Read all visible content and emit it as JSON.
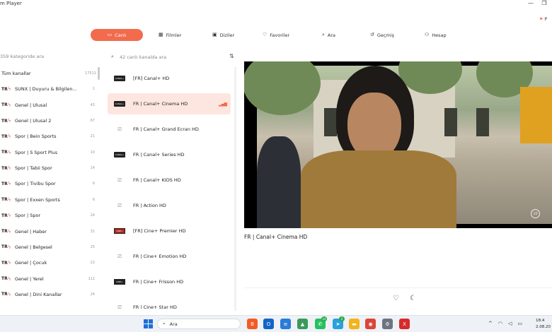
{
  "window": {
    "title": "m Player",
    "minimize": "—",
    "restore": "❐"
  },
  "top_right": {
    "label": "P"
  },
  "nav": {
    "items": [
      {
        "label": "Canlı",
        "icon": "tv-icon",
        "glyph": "▭",
        "active": true
      },
      {
        "label": "Filmler",
        "icon": "film-icon",
        "glyph": "▦",
        "active": false
      },
      {
        "label": "Diziler",
        "icon": "series-icon",
        "glyph": "▣",
        "active": false
      },
      {
        "label": "Favoriler",
        "icon": "heart-icon",
        "glyph": "♡",
        "active": false
      },
      {
        "label": "Ara",
        "icon": "search-icon",
        "glyph": "⌕",
        "active": false
      },
      {
        "label": "Geçmiş",
        "icon": "history-icon",
        "glyph": "↺",
        "active": false
      },
      {
        "label": "Hesap",
        "icon": "user-icon",
        "glyph": "⚇",
        "active": false
      }
    ]
  },
  "categories": {
    "search_placeholder": "359 kategoride ara",
    "items": [
      {
        "prefix": "",
        "name": "Tüm kanallar",
        "count": "17511"
      },
      {
        "prefix": "TR",
        "name": "SUNX | Duyuru & Bilgilen...",
        "count": "1"
      },
      {
        "prefix": "TR",
        "name": "Genel | Ulusal",
        "count": "43"
      },
      {
        "prefix": "TR",
        "name": "Genel | Ulusal 2",
        "count": "67"
      },
      {
        "prefix": "TR",
        "name": "Spor | Bein Sports",
        "count": "21"
      },
      {
        "prefix": "TR",
        "name": "Spor | S Sport Plus",
        "count": "10"
      },
      {
        "prefix": "TR",
        "name": "Spor | Tabii Spor",
        "count": "14"
      },
      {
        "prefix": "TR",
        "name": "Spor | Tivibu Spor",
        "count": "6"
      },
      {
        "prefix": "TR",
        "name": "Spor | Exxen Sports",
        "count": "6"
      },
      {
        "prefix": "TR",
        "name": "Spor | Spor",
        "count": "24"
      },
      {
        "prefix": "TR",
        "name": "Genel | Haber",
        "count": "31"
      },
      {
        "prefix": "TR",
        "name": "Genel | Belgesel",
        "count": "25"
      },
      {
        "prefix": "TR",
        "name": "Genel | Çocuk",
        "count": "22"
      },
      {
        "prefix": "TR",
        "name": "Genel | Yerel",
        "count": "111"
      },
      {
        "prefix": "TR",
        "name": "Genel | Dini Kanallar",
        "count": "24"
      }
    ]
  },
  "channels": {
    "search_placeholder": "42 canlı kanalda ara",
    "items": [
      {
        "name": "[FR] Canal+ HD",
        "logo": "brand",
        "logo_text": "CANAL+",
        "selected": false
      },
      {
        "name": "FR | Canal+ Cinema HD",
        "logo": "brand",
        "logo_text": "CANAL+",
        "selected": true
      },
      {
        "name": "FR | Canal+ Grand Ecran HD",
        "logo": "tv",
        "logo_text": "",
        "selected": false
      },
      {
        "name": "FR | Canal+ Series HD",
        "logo": "brand",
        "logo_text": "CANAL+",
        "selected": false
      },
      {
        "name": "FR | Canal+ KIDS HD",
        "logo": "tv",
        "logo_text": "",
        "selected": false
      },
      {
        "name": "FR | Action HD",
        "logo": "tv",
        "logo_text": "",
        "selected": false
      },
      {
        "name": "[FR] Cine+ Premier HD",
        "logo": "cine",
        "logo_text": "CINE+",
        "selected": false
      },
      {
        "name": "FR | Cine+ Emotion HD",
        "logo": "tv",
        "logo_text": "",
        "selected": false
      },
      {
        "name": "FR | Cine+ Frisson HD",
        "logo": "frisson",
        "logo_text": "CINE+",
        "selected": false
      },
      {
        "name": "FR | Cine+ Star HD",
        "logo": "tv",
        "logo_text": "",
        "selected": false
      }
    ]
  },
  "player": {
    "now_playing": "FR | Canal+ Cinema HD",
    "badge": "10"
  },
  "taskbar": {
    "search_label": "Ara",
    "apps": [
      {
        "name": "brave-app-icon",
        "glyph": "B",
        "color": "#f25b24",
        "badge": ""
      },
      {
        "name": "outlook-app-icon",
        "glyph": "O",
        "color": "#1066c4",
        "badge": ""
      },
      {
        "name": "notes-app-icon",
        "glyph": "≡",
        "color": "#2b7bd8",
        "badge": ""
      },
      {
        "name": "photos-app-icon",
        "glyph": "▲",
        "color": "#3a9a5a",
        "badge": ""
      },
      {
        "name": "whatsapp-app-icon",
        "glyph": "✆",
        "color": "#25c161",
        "badge": "14"
      },
      {
        "name": "telegram-app-icon",
        "glyph": "➤",
        "color": "#2aa1dd",
        "badge": "2"
      },
      {
        "name": "files-app-icon",
        "glyph": "▬",
        "color": "#f2b41b",
        "badge": ""
      },
      {
        "name": "chrome-app-icon",
        "glyph": "◉",
        "color": "#db4437",
        "badge": ""
      },
      {
        "name": "settings-app-icon",
        "glyph": "⚙",
        "color": "#6c7480",
        "badge": ""
      },
      {
        "name": "player-app-icon",
        "glyph": "X",
        "color": "#d62a2a",
        "badge": ""
      }
    ],
    "tray_chevron": "^",
    "clock_time": "18:4",
    "clock_date": "2.08.20"
  },
  "colors": {
    "accent": "#f26b4d",
    "selected_row": "#fde6df"
  }
}
